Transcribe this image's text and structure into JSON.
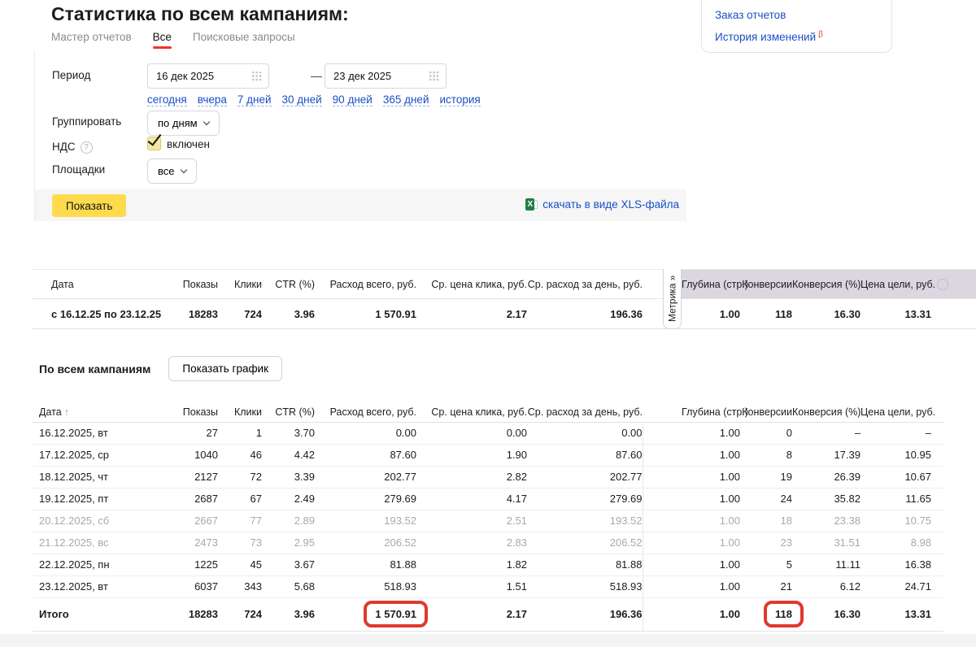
{
  "page": {
    "title": "Статистика по всем кампаниям:"
  },
  "tabs": [
    {
      "label": "Мастер отчетов"
    },
    {
      "label": "Все"
    },
    {
      "label": "Поисковые запросы"
    }
  ],
  "links_panel": {
    "order_reports": "Заказ отчетов",
    "change_history": "История изменений",
    "beta_badge": "β"
  },
  "form": {
    "period_label": "Период",
    "date_from": "16 дек 2025",
    "date_to": "23 дек 2025",
    "date_separator": "—",
    "quick_ranges": [
      "сегодня",
      "вчера",
      "7 дней",
      "30 дней",
      "90 дней",
      "365 дней",
      "история"
    ],
    "group_label": "Группировать",
    "group_value": "по дням",
    "vat_label": "НДС",
    "vat_help_icon": "?",
    "vat_checkbox_label": "включен",
    "platforms_label": "Площадки",
    "platforms_value": "все",
    "show_button": "Показать",
    "xls_link": "скачать в виде XLS-файла",
    "xls_icon_letter": "X"
  },
  "table_columns": [
    "Дата",
    "Показы",
    "Клики",
    "CTR (%)",
    "Расход всего, руб.",
    "Ср. цена клика, руб.",
    "Ср. расход за день, руб.",
    "Глубина (стр.)",
    "Конверсии",
    "Конверсия (%)",
    "Цена цели, руб."
  ],
  "summary_table": {
    "metrics_tab": "Метрика »",
    "row": {
      "label": "с 16.12.25 по 23.12.25",
      "values": [
        "18283",
        "724",
        "3.96",
        "1 570.91",
        "2.17",
        "196.36",
        "1.00",
        "118",
        "16.30",
        "13.31"
      ]
    }
  },
  "campaigns_section": {
    "title": "По всем кампаниям",
    "chart_button": "Показать график",
    "sort_arrow": "↑"
  },
  "details_table": {
    "rows": [
      {
        "date": "16.12.2025, вт",
        "values": [
          "27",
          "1",
          "3.70",
          "0.00",
          "0.00",
          "0.00",
          "1.00",
          "0",
          "–",
          "–"
        ]
      },
      {
        "date": "17.12.2025, ср",
        "values": [
          "1040",
          "46",
          "4.42",
          "87.60",
          "1.90",
          "87.60",
          "1.00",
          "8",
          "17.39",
          "10.95"
        ]
      },
      {
        "date": "18.12.2025, чт",
        "values": [
          "2127",
          "72",
          "3.39",
          "202.77",
          "2.82",
          "202.77",
          "1.00",
          "19",
          "26.39",
          "10.67"
        ]
      },
      {
        "date": "19.12.2025, пт",
        "values": [
          "2687",
          "67",
          "2.49",
          "279.69",
          "4.17",
          "279.69",
          "1.00",
          "24",
          "35.82",
          "11.65"
        ]
      },
      {
        "date": "20.12.2025, сб",
        "values": [
          "2667",
          "77",
          "2.89",
          "193.52",
          "2.51",
          "193.52",
          "1.00",
          "18",
          "23.38",
          "10.75"
        ]
      },
      {
        "date": "21.12.2025, вс",
        "values": [
          "2473",
          "73",
          "2.95",
          "206.52",
          "2.83",
          "206.52",
          "1.00",
          "23",
          "31.51",
          "8.98"
        ]
      },
      {
        "date": "22.12.2025, пн",
        "values": [
          "1225",
          "45",
          "3.67",
          "81.88",
          "1.82",
          "81.88",
          "1.00",
          "5",
          "11.11",
          "16.38"
        ]
      },
      {
        "date": "23.12.2025, вт",
        "values": [
          "6037",
          "343",
          "5.68",
          "518.93",
          "1.51",
          "518.93",
          "1.00",
          "21",
          "6.12",
          "24.71"
        ]
      }
    ],
    "total": {
      "label": "Итого",
      "values": [
        "18283",
        "724",
        "3.96",
        "1 570.91",
        "2.17",
        "196.36",
        "1.00",
        "118",
        "16.30",
        "13.31"
      ]
    }
  },
  "colors": {
    "accent_yellow": "#fedb4d",
    "link_blue": "#1a4fc4",
    "tab_underline_red": "#ee3626",
    "annotation_red": "#e0392b",
    "metric_header_purple": "#dbd6e0"
  }
}
